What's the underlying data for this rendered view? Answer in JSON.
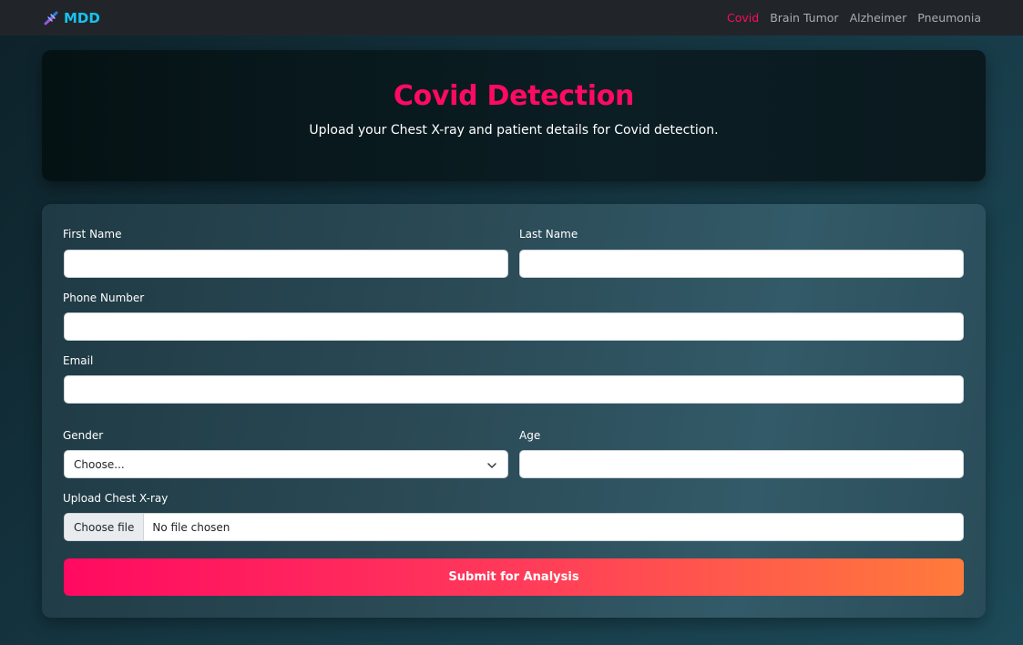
{
  "navbar": {
    "brand": "MDD",
    "brand_icon": "dna-icon",
    "links": [
      {
        "label": "Covid",
        "active": true
      },
      {
        "label": "Brain Tumor",
        "active": false
      },
      {
        "label": "Alzheimer",
        "active": false
      },
      {
        "label": "Pneumonia",
        "active": false
      }
    ]
  },
  "hero": {
    "title": "Covid Detection",
    "subtitle": "Upload your Chest X-ray and patient details for Covid detection."
  },
  "form": {
    "first_name": {
      "label": "First Name",
      "value": ""
    },
    "last_name": {
      "label": "Last Name",
      "value": ""
    },
    "phone": {
      "label": "Phone Number",
      "value": ""
    },
    "email": {
      "label": "Email",
      "value": ""
    },
    "gender": {
      "label": "Gender",
      "selected": "Choose..."
    },
    "age": {
      "label": "Age",
      "value": ""
    },
    "upload": {
      "label": "Upload Chest X-ray",
      "button": "Choose file",
      "status": "No file chosen"
    },
    "submit": "Submit for Analysis"
  },
  "colors": {
    "accent": "#ff0a62",
    "brand": "#17c2f0",
    "navbar_bg": "#212529",
    "submit_gradient_start": "#ff0a61",
    "submit_gradient_end": "#ff7b3b"
  }
}
